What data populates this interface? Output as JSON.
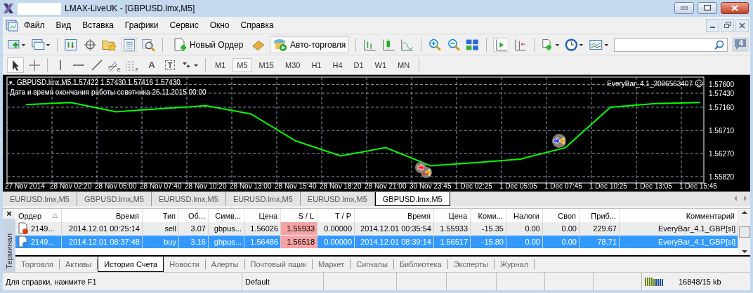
{
  "window": {
    "title": "LMAX-LiveUK - [GBPUSD.lmx,M5]"
  },
  "menu": [
    "Файл",
    "Вид",
    "Вставка",
    "Графики",
    "Сервис",
    "Окно",
    "Справка"
  ],
  "toolbar": {
    "new_order": "Новый Ордер",
    "auto_trading": {
      "label": "Авто-торговля",
      "on": true
    },
    "data_window_on": true,
    "autoscroll_on": true,
    "notifications": "4"
  },
  "tools": {
    "cursor_on": true,
    "fibo_channel_mark": "E",
    "fibo_levels_mark": "F",
    "text_glyph": "A",
    "label_glyph": "T"
  },
  "timeframes": [
    {
      "label": "M1",
      "selected": false
    },
    {
      "label": "M5",
      "selected": true
    },
    {
      "label": "M15",
      "selected": false
    },
    {
      "label": "M30",
      "selected": false
    },
    {
      "label": "H1",
      "selected": false
    },
    {
      "label": "H4",
      "selected": false
    },
    {
      "label": "D1",
      "selected": false
    },
    {
      "label": "W1",
      "selected": false
    },
    {
      "label": "MN",
      "selected": false
    }
  ],
  "chart": {
    "menu_glyph": "▾",
    "ohlc": "1.57422 1.57430 1.57416 1.57430",
    "expert_note": "Дата и время окончания работы советника 26.11.2015 00:00",
    "expert_name": "EveryBar_4.1_2096563407",
    "chart_data": {
      "type": "line",
      "x": [
        "27 Nov 2014",
        "28 Nov 02:20",
        "28 Nov 05:00",
        "28 Nov 07:40",
        "28 Nov 10:20",
        "28 Nov 13:00",
        "28 Nov 15:40",
        "28 Nov 18:20",
        "28 Nov 21:00",
        "30 Nov 23:45",
        "1 Dec 02:25",
        "1 Dec 05:05",
        "1 Dec 07:45",
        "1 Dec 10:25",
        "1 Dec 13:05",
        "1 Dec 15:45"
      ],
      "series": [
        {
          "name": "GBPUSD.lmx,M5",
          "color": "#00ff00",
          "values": [
            1.5721,
            1.5725,
            1.5707,
            1.5713,
            1.5719,
            1.5703,
            1.5651,
            1.5622,
            1.5638,
            1.5603,
            1.5609,
            1.5616,
            1.5638,
            1.5716,
            1.5723,
            1.5725
          ]
        }
      ],
      "ylim": [
        1.5582,
        1.576
      ],
      "grid": true,
      "yticks": [
        {
          "value": 1.576,
          "label": "1.57600"
        },
        {
          "value": 1.5743,
          "label": "1.57430"
        },
        {
          "value": 1.5716,
          "label": "1.57160"
        },
        {
          "value": 1.5671,
          "label": "1.56710"
        },
        {
          "value": 1.5627,
          "label": "1.56270"
        },
        {
          "value": 1.5582,
          "label": "1.55820"
        }
      ]
    }
  },
  "chart_tabs": [
    {
      "label": "EURUSD.lmx,M5",
      "selected": false
    },
    {
      "label": "GBPUSD.lmx,M5",
      "selected": false
    },
    {
      "label": "EURUSD.lmx,M5",
      "selected": false
    },
    {
      "label": "EURUSD.lmx,M5",
      "selected": false
    },
    {
      "label": "EURUSD.lmx,M5",
      "selected": false
    },
    {
      "label": "GBPUSD.lmx,M5",
      "selected": true
    }
  ],
  "terminal": {
    "title": "Терминал",
    "close": "×",
    "columns": [
      "Ордер",
      "Время",
      "Тип",
      "Об...",
      "Симв...",
      "Цена",
      "S / L",
      "T / P",
      "Время",
      "Цена",
      "Коми...",
      "Налоги",
      "Своп",
      "Приб...",
      "Комментарий"
    ],
    "rows": [
      {
        "selected": false,
        "sl_hit": true,
        "color": "#e0400f",
        "cells": [
          "2149...",
          "2014.12.01 00:25:14",
          "sell",
          "3.07",
          "gbpus...",
          "1.56026",
          "1.55933",
          "0.00000",
          "2014.12.01 00:35:54",
          "1.55933",
          "-15.35",
          "0.00",
          "0.00",
          "229.67",
          "EveryBar_4.1_GBP[sl]"
        ]
      },
      {
        "selected": true,
        "sl_hit": true,
        "color": "#2a8ae0",
        "cells": [
          "2149...",
          "2014.12.01 08:37:48",
          "buy",
          "3.16",
          "gbpus...",
          "1.56486",
          "1.56518",
          "0.00000",
          "2014.12.01 08:39:14",
          "1.56517",
          "-15.80",
          "0.00",
          "0.00",
          "78.71",
          "EveryBar_4.1_GBP[sl]"
        ]
      }
    ],
    "tabs": [
      {
        "label": "Торговля",
        "selected": false
      },
      {
        "label": "Активы",
        "selected": false
      },
      {
        "label": "История Счета",
        "selected": true
      },
      {
        "label": "Новости",
        "selected": false
      },
      {
        "label": "Алерты",
        "selected": false
      },
      {
        "label": "Почтовый ящик",
        "selected": false
      },
      {
        "label": "Маркет",
        "selected": false
      },
      {
        "label": "Сигналы",
        "selected": false
      },
      {
        "label": "Библиотека",
        "selected": false
      },
      {
        "label": "Эксперты",
        "selected": false
      },
      {
        "label": "Журнал",
        "selected": false
      }
    ]
  },
  "status_bar": {
    "help": "Для справки, нажмите F1",
    "profile": "Default",
    "traffic": "16848/15 kb"
  }
}
